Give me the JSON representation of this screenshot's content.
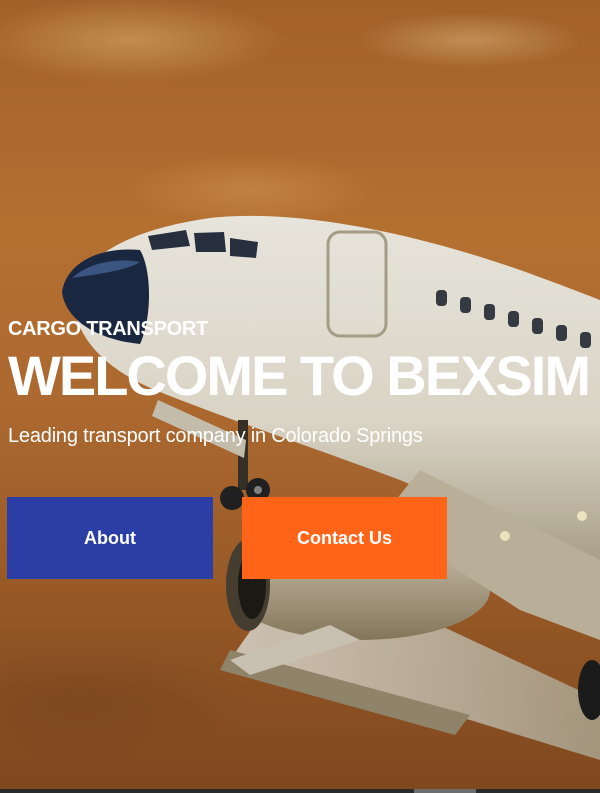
{
  "hero": {
    "eyebrow": "CARGO TRANSPORT",
    "headline": "WELCOME TO BEXSIM I",
    "subline": "Leading transport company in Colorado Springs"
  },
  "buttons": {
    "about_label": "About",
    "contact_label": "Contact Us"
  },
  "colors": {
    "about_button": "#2a3ea6",
    "contact_button": "#ff6418",
    "text": "#ffffff"
  },
  "icons": {
    "background": "airplane-illustration"
  }
}
